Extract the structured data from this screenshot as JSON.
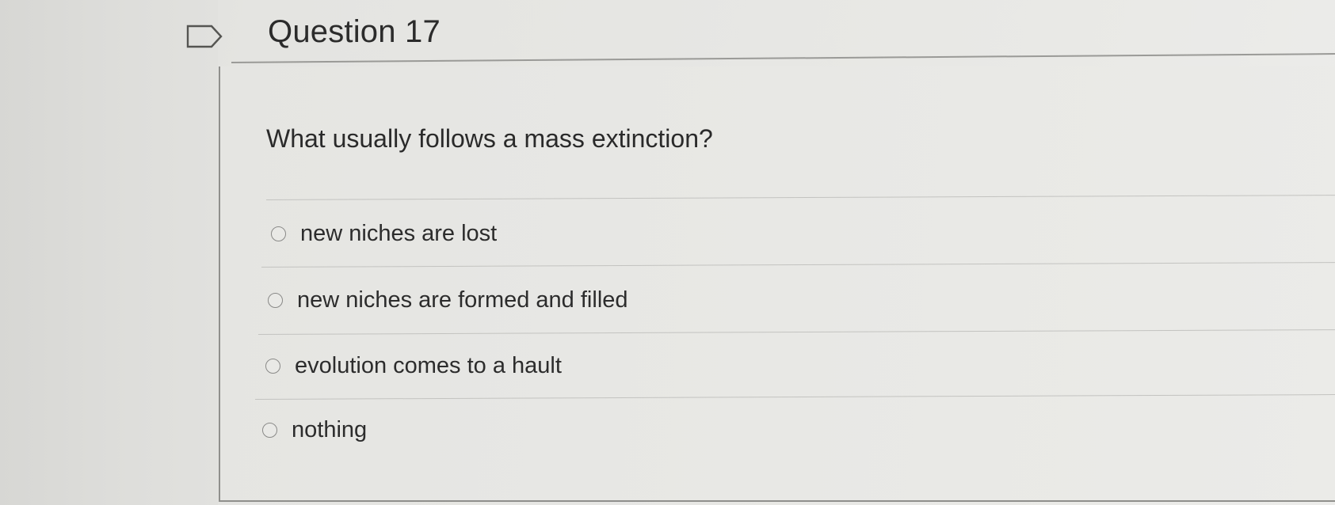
{
  "question": {
    "title": "Question 17",
    "prompt": "What usually follows a mass extinction?",
    "options": [
      {
        "label": "new niches are lost"
      },
      {
        "label": "new niches are formed and filled"
      },
      {
        "label": "evolution comes to a hault"
      },
      {
        "label": "nothing"
      }
    ]
  },
  "icons": {
    "flag": "flag-outline-icon",
    "radio": "radio-button-icon"
  },
  "colors": {
    "text": "#2b2b2b",
    "rule": "#9a9a97",
    "background": "#e6e6e3"
  }
}
